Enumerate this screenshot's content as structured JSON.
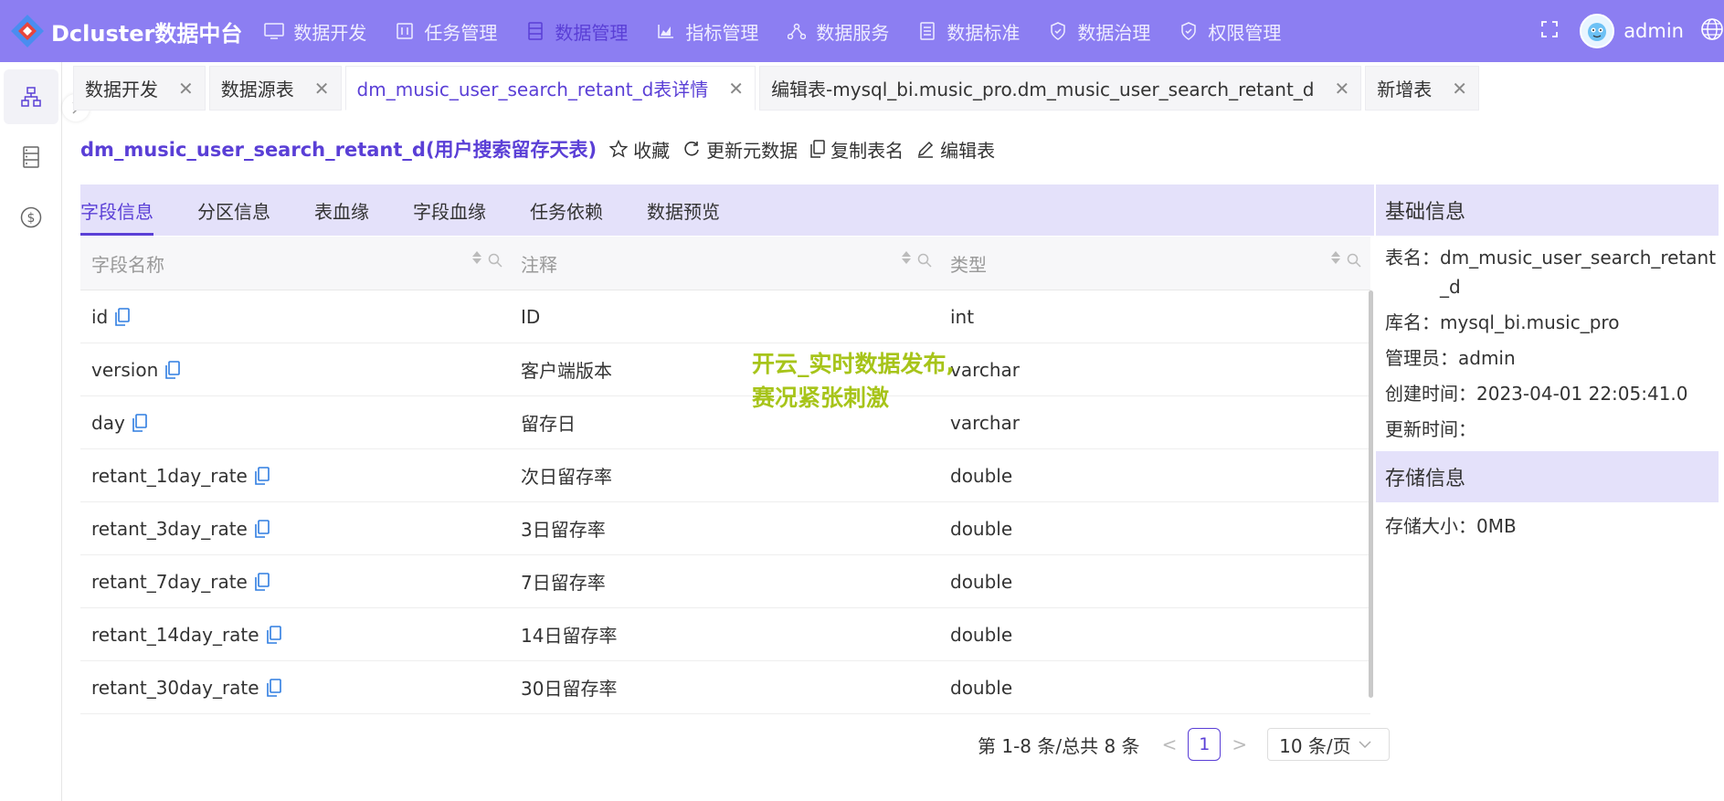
{
  "app": {
    "title": "Dcluster数据中台",
    "colors": {
      "accent": "#5a3fd6",
      "header_bg": "#8c7ef2",
      "subtab_bg": "#e4e1fa"
    }
  },
  "nav": {
    "items": [
      {
        "label": "数据开发",
        "icon": "sql-icon",
        "active": false
      },
      {
        "label": "任务管理",
        "icon": "task-icon",
        "active": false
      },
      {
        "label": "数据管理",
        "icon": "database-icon",
        "active": true
      },
      {
        "label": "指标管理",
        "icon": "chart-icon",
        "active": false
      },
      {
        "label": "数据服务",
        "icon": "network-icon",
        "active": false
      },
      {
        "label": "数据标准",
        "icon": "document-icon",
        "active": false
      },
      {
        "label": "数据治理",
        "icon": "shield-icon",
        "active": false
      },
      {
        "label": "权限管理",
        "icon": "shield-check-icon",
        "active": false
      }
    ],
    "user": "admin"
  },
  "tabs": [
    {
      "label": "数据开发",
      "active": false
    },
    {
      "label": "数据源表",
      "active": false
    },
    {
      "label": "dm_music_user_search_retant_d表详情",
      "active": true
    },
    {
      "label": "编辑表-mysql_bi.music_pro.dm_music_user_search_retant_d",
      "active": false
    },
    {
      "label": "新增表",
      "active": false
    }
  ],
  "page": {
    "title": "dm_music_user_search_retant_d(用户搜索留存天表)",
    "actions": {
      "favorite": "收藏",
      "refresh": "更新元数据",
      "copy": "复制表名",
      "edit": "编辑表"
    }
  },
  "subtabs": [
    "字段信息",
    "分区信息",
    "表血缘",
    "字段血缘",
    "任务依赖",
    "数据预览"
  ],
  "table": {
    "headers": [
      "字段名称",
      "注释",
      "类型"
    ],
    "rows": [
      [
        "id",
        "ID",
        "int"
      ],
      [
        "version",
        "客户端版本",
        "varchar"
      ],
      [
        "day",
        "留存日",
        "varchar"
      ],
      [
        "retant_1day_rate",
        "次日留存率",
        "double"
      ],
      [
        "retant_3day_rate",
        "3日留存率",
        "double"
      ],
      [
        "retant_7day_rate",
        "7日留存率",
        "double"
      ],
      [
        "retant_14day_rate",
        "14日留存率",
        "double"
      ],
      [
        "retant_30day_rate",
        "30日留存率",
        "double"
      ]
    ]
  },
  "pagination": {
    "summary": "第 1-8 条/总共 8 条",
    "current": "1",
    "page_size": "10 条/页"
  },
  "basic_info": {
    "title": "基础信息",
    "rows": [
      {
        "k": "表名：",
        "v": "dm_music_user_search_retant_d"
      },
      {
        "k": "库名：",
        "v": "mysql_bi.music_pro"
      },
      {
        "k": "管理员：",
        "v": "admin"
      },
      {
        "k": "创建时间：",
        "v": "2023-04-01 22:05:41.0"
      },
      {
        "k": "更新时间：",
        "v": ""
      }
    ]
  },
  "storage_info": {
    "title": "存储信息",
    "rows": [
      {
        "k": "存储大小：",
        "v": "0MB"
      }
    ]
  },
  "watermark": {
    "line1": "开云_实时数据发布,",
    "line2": "赛况紧张刺激"
  }
}
